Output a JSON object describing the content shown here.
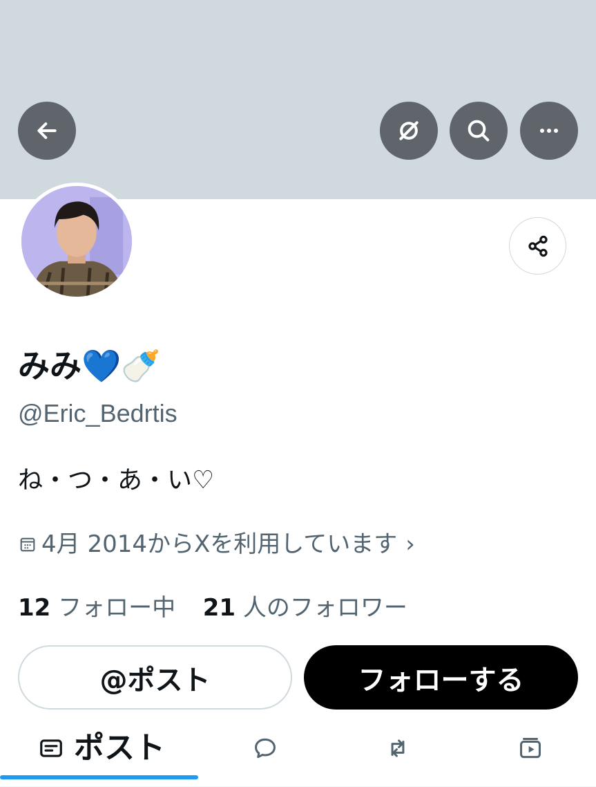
{
  "colors": {
    "banner": "#cfd9de",
    "secondary_text": "#536471",
    "follow_button": "#000000",
    "tab_indicator": "#1d9bf0"
  },
  "header": {
    "back_icon": "arrow-left-icon",
    "grok_icon": "grok-icon",
    "search_icon": "search-icon",
    "more_icon": "more-horizontal-icon"
  },
  "profile": {
    "display_name": "みみ💙🍼",
    "handle": "@Eric_Bedrtis",
    "bio": "ね・つ・あ・い♡",
    "joined": "4月 2014からXを利用しています",
    "following_count": "12",
    "following_label": "フォロー中",
    "followers_count": "21",
    "followers_label": "人のフォロワー"
  },
  "actions": {
    "mention_label": "@ポスト",
    "follow_label": "フォローする",
    "share_icon": "share-icon"
  },
  "tabs": {
    "posts_label": "ポスト",
    "posts_icon": "posts-icon",
    "replies_icon": "reply-icon",
    "reposts_icon": "repost-icon",
    "media_icon": "media-icon"
  }
}
